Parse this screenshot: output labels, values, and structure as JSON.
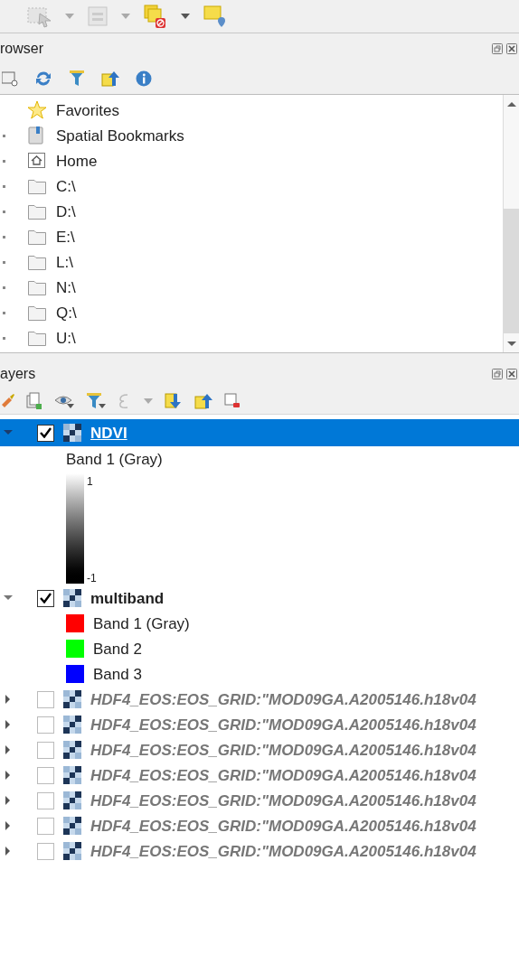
{
  "browser": {
    "title": "rowser",
    "items": [
      {
        "kind": "favorites",
        "label": "Favorites",
        "expandable": false
      },
      {
        "kind": "bookmarks",
        "label": "Spatial Bookmarks",
        "expandable": true
      },
      {
        "kind": "home",
        "label": "Home",
        "expandable": true
      },
      {
        "kind": "drive",
        "label": "C:\\",
        "expandable": true
      },
      {
        "kind": "drive",
        "label": "D:\\",
        "expandable": true
      },
      {
        "kind": "drive",
        "label": "E:\\",
        "expandable": true
      },
      {
        "kind": "drive",
        "label": "L:\\",
        "expandable": true
      },
      {
        "kind": "drive",
        "label": "N:\\",
        "expandable": true
      },
      {
        "kind": "drive",
        "label": "Q:\\",
        "expandable": true
      },
      {
        "kind": "drive",
        "label": "U:\\",
        "expandable": true
      }
    ]
  },
  "layers": {
    "title": "ayers",
    "items": [
      {
        "name": "NDVI",
        "checked": true,
        "selected": true,
        "expanded": true,
        "children": [
          {
            "kind": "label",
            "label": "Band 1 (Gray)"
          },
          {
            "kind": "gradient",
            "max": "1",
            "min": "-1"
          }
        ]
      },
      {
        "name": "multiband",
        "checked": true,
        "selected": false,
        "expanded": true,
        "children": [
          {
            "kind": "swatch",
            "label": "Band 1 (Gray)",
            "color": "#ff0000"
          },
          {
            "kind": "swatch",
            "label": "Band 2",
            "color": "#00ff00"
          },
          {
            "kind": "swatch",
            "label": "Band 3",
            "color": "#0000ff"
          }
        ]
      },
      {
        "name": "HDF4_EOS:EOS_GRID:\"MOD09GA.A2005146.h18v04",
        "checked": false,
        "selected": false,
        "expanded": false
      },
      {
        "name": "HDF4_EOS:EOS_GRID:\"MOD09GA.A2005146.h18v04",
        "checked": false,
        "selected": false,
        "expanded": false
      },
      {
        "name": "HDF4_EOS:EOS_GRID:\"MOD09GA.A2005146.h18v04",
        "checked": false,
        "selected": false,
        "expanded": false
      },
      {
        "name": "HDF4_EOS:EOS_GRID:\"MOD09GA.A2005146.h18v04",
        "checked": false,
        "selected": false,
        "expanded": false
      },
      {
        "name": "HDF4_EOS:EOS_GRID:\"MOD09GA.A2005146.h18v04",
        "checked": false,
        "selected": false,
        "expanded": false
      },
      {
        "name": "HDF4_EOS:EOS_GRID:\"MOD09GA.A2005146.h18v04",
        "checked": false,
        "selected": false,
        "expanded": false
      },
      {
        "name": "HDF4_EOS:EOS_GRID:\"MOD09GA.A2005146.h18v04",
        "checked": false,
        "selected": false,
        "expanded": false
      }
    ]
  }
}
